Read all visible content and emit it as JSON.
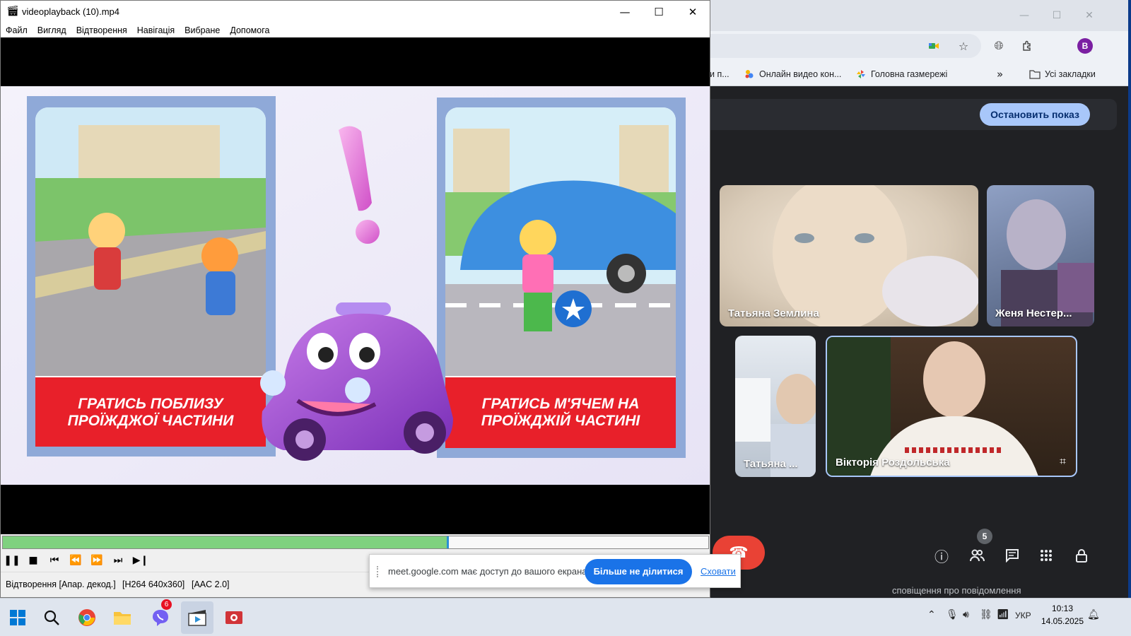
{
  "player": {
    "title": "videoplayback (10).mp4",
    "window_controls": {
      "minimize": "—",
      "maximize": "☐",
      "close": "✕"
    },
    "menu": [
      "Файл",
      "Вигляд",
      "Відтворення",
      "Навігація",
      "Вибране",
      "Допомога"
    ],
    "video": {
      "left_card_caption_line1": "ГРАТИСЬ ПОБЛИЗУ",
      "left_card_caption_line2": "ПРОЇЖДЖОЇ ЧАСТИНИ",
      "right_card_caption_line1": "ГРАТИСЬ М'ЯЧЕМ НА",
      "right_card_caption_line2": "ПРОЇЖДЖІЙ ЧАСТИНІ",
      "exclamation": "!"
    },
    "progress_fraction": 0.632,
    "transport_icons": [
      "pause-icon",
      "stop-icon",
      "skip-back-icon",
      "rewind-icon",
      "fast-forward-icon",
      "skip-forward-icon",
      "frame-step-icon"
    ],
    "status": {
      "playback": "Відтворення [Апар. декод.]",
      "video_codec": "[H264 640x360]",
      "audio_codec": "[AAC 2.0]"
    }
  },
  "share_notice": {
    "message": "meet.google.com має доступ до вашого екрана.",
    "stop_button": "Більше не ділитися",
    "hide_link": "Сховати"
  },
  "browser": {
    "profile_initial": "B",
    "bookmarks": [
      {
        "label": "и п...",
        "icon": ""
      },
      {
        "label": "Онлайн видео кон...",
        "icon": "meet-bookmark-icon"
      },
      {
        "label": "Головна газмережі",
        "icon": "pinwheel-icon"
      }
    ],
    "more_bookmarks": "»",
    "all_bookmarks": "Усі закладки"
  },
  "meet": {
    "stop_presenting": "Остановить показ",
    "participants": [
      {
        "name": "Татьяна Землина",
        "tone": "#d9cbb8"
      },
      {
        "name": "Женя Нестер...",
        "tone": "#6a7c9c"
      },
      {
        "name": "Татьяна ...",
        "tone": "#cfd8e2"
      },
      {
        "name": "Вікторія Роздольська",
        "tone": "#5a3f2c"
      }
    ],
    "people_count": "5",
    "toast_peek": "сповіщення про повідомлення"
  },
  "taskbar": {
    "viber_badge": "6",
    "language": "УКР",
    "time": "10:13",
    "date": "14.05.2025"
  },
  "colors": {
    "progress_fill": "#7fd17f",
    "progress_head": "#2b8fd6",
    "meet_bg": "#202124",
    "stop_share_bg": "#a8c7fa",
    "hangup_red": "#e94235",
    "caption_red": "#e8202a",
    "card_frame": "#8fa9d8"
  }
}
